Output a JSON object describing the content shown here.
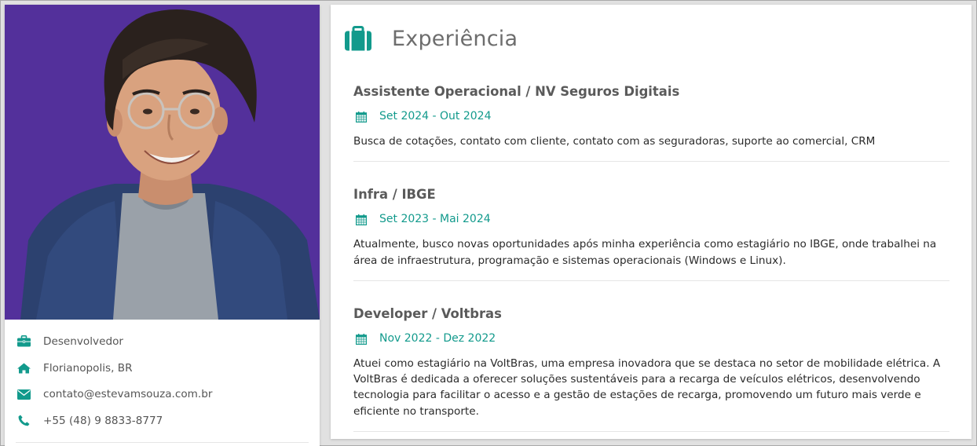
{
  "profile": {
    "photo_alt": "",
    "info": [
      {
        "icon": "briefcase-icon",
        "text": "Desenvolvedor"
      },
      {
        "icon": "home-icon",
        "text": "Florianopolis, BR"
      },
      {
        "icon": "envelope-icon",
        "text": "contato@estevamsouza.com.br"
      },
      {
        "icon": "phone-icon",
        "text": "+55 (48) 9 8833-8777"
      }
    ]
  },
  "experience": {
    "title": "Experiência",
    "icon": "briefcase-icon",
    "entries": [
      {
        "title": "Assistente Operacional / NV Seguros Digitais",
        "date": "Set 2024 - Out 2024",
        "description": "Busca de cotações, contato com cliente, contato com as seguradoras, suporte ao comercial, CRM"
      },
      {
        "title": "Infra / IBGE",
        "date": "Set 2023 - Mai 2024",
        "description": "Atualmente, busco novas oportunidades após minha experiência como estagiário no IBGE, onde trabalhei na área de infraestrutura, programação e sistemas operacionais (Windows e Linux)."
      },
      {
        "title": "Developer / Voltbras",
        "date": "Nov 2022 - Dez 2022",
        "description": "Atuei como estagiário na VoltBras, uma empresa inovadora que se destaca no setor de mobilidade elétrica. A VoltBras é dedicada a oferecer soluções sustentáveis para a recarga de veículos elétricos, desenvolvendo tecnologia para facilitar o acesso e a gestão de estações de recarga, promovendo um futuro mais verde e eficiente no transporte."
      }
    ]
  },
  "colors": {
    "accent": "#129a8c",
    "photo_background": "#53309b"
  }
}
